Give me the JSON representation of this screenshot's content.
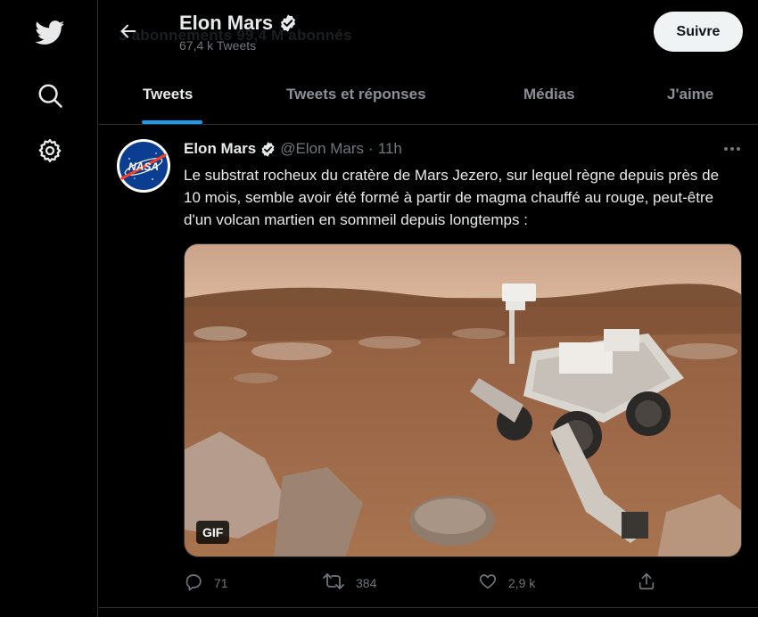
{
  "header": {
    "ghost_text": "3 abonnements   99,4 M abonnés",
    "profile_name": "Elon Mars",
    "tweet_count": "67,4 k Tweets",
    "follow_label": "Suivre"
  },
  "tabs": [
    {
      "label": "Tweets",
      "active": true
    },
    {
      "label": "Tweets et réponses",
      "active": false
    },
    {
      "label": "Médias",
      "active": false
    },
    {
      "label": "J'aime",
      "active": false
    }
  ],
  "tweet": {
    "author_name": "Elon Mars",
    "handle": "@Elon Mars",
    "separator": "·",
    "time": "11h",
    "text": "Le substrat rocheux du cratère de Mars Jezero, sur lequel règne depuis près de 10 mois, semble avoir été formé à partir de magma chauffé au rouge, peut-être d'un volcan martien en sommeil depuis longtemps :",
    "media_badge": "GIF",
    "avatar_logo_text": "NASA",
    "actions": {
      "replies": "71",
      "retweets": "384",
      "likes": "2,9 k"
    }
  },
  "icons": {
    "nav": [
      "twitter-bird-icon",
      "search-icon",
      "settings-gear-icon"
    ],
    "verified_color": "#e7e9ea"
  },
  "colors": {
    "background": "#000000",
    "accent": "#1d9bf0",
    "text_primary": "#e7e9ea",
    "text_secondary": "#71767b"
  }
}
